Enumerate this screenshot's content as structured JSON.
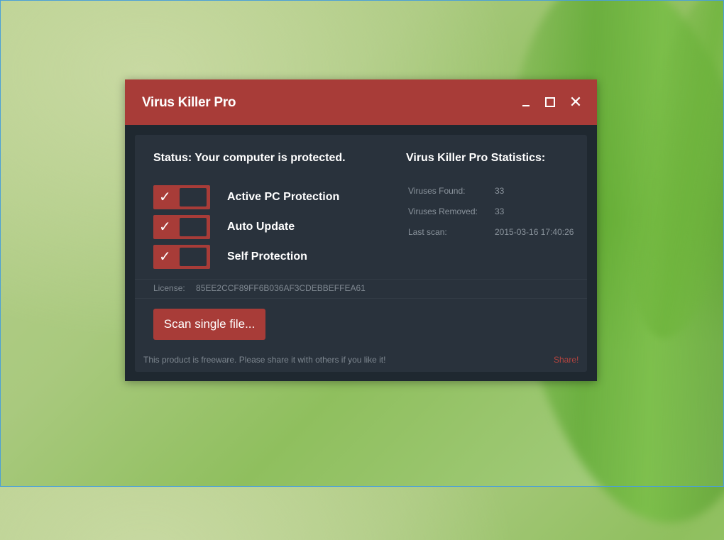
{
  "window": {
    "title": "Virus Killer Pro",
    "accent_color": "#a83c38",
    "background_color": "#29323c"
  },
  "status": {
    "text": "Status: Your computer is protected."
  },
  "toggles": [
    {
      "label": "Active PC Protection",
      "checked": true,
      "check_glyph": "✓"
    },
    {
      "label": "Auto Update",
      "checked": true,
      "check_glyph": "✓"
    },
    {
      "label": "Self Protection",
      "checked": true,
      "check_glyph": "✓"
    }
  ],
  "statistics": {
    "title": "Virus Killer Pro Statistics:",
    "rows": [
      {
        "label": "Viruses Found:",
        "value": "33"
      },
      {
        "label": "Viruses Removed:",
        "value": "33"
      },
      {
        "label": "Last scan:",
        "value": "2015-03-16 17:40:26"
      }
    ]
  },
  "license": {
    "label": "License:",
    "value": "85EE2CCF89FF6B036AF3CDEBBEFFEA61"
  },
  "scan_button": {
    "label": "Scan single file..."
  },
  "footer": {
    "text": "This product is freeware. Please share it with others if you like it!",
    "share_label": "Share!"
  },
  "window_controls": {
    "close_glyph": "✕"
  }
}
